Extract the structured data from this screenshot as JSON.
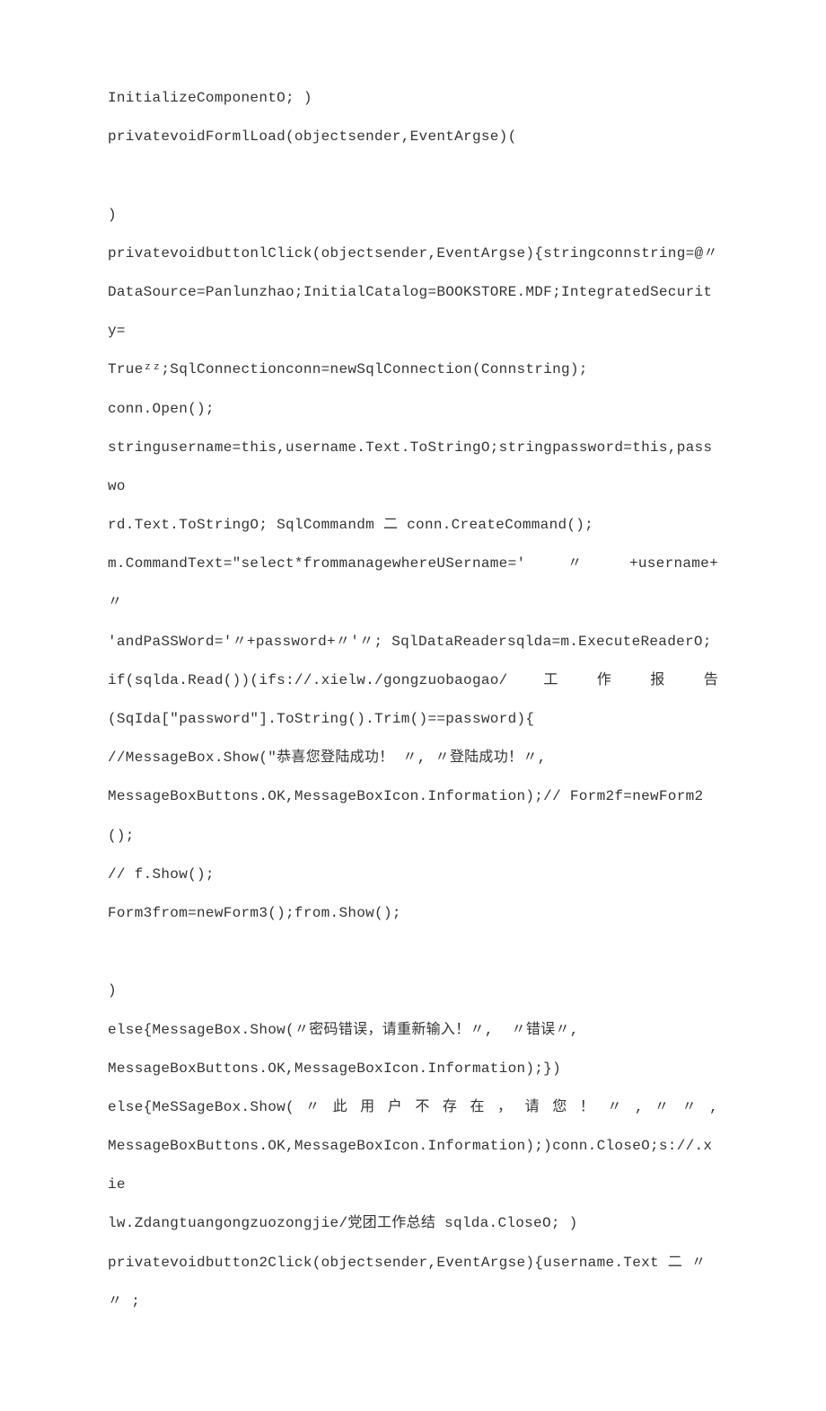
{
  "lines": [
    {
      "text": "InitializeComponentO; )",
      "cls": "line mono"
    },
    {
      "text": "privatevoidFormlLoad(objectsender,EventArgse)(",
      "cls": "line mono"
    },
    {
      "text": " ",
      "cls": "line"
    },
    {
      "text": ")",
      "cls": "line mono"
    },
    {
      "text": "privatevoidbuttonlClick(objectsender,EventArgse){stringconnstring=@〃",
      "cls": "line mono"
    },
    {
      "text": "DataSource=Panlunzhao;InitialCatalog=BOOKSTORE.MDF;IntegratedSecurity=",
      "cls": "line mono"
    },
    {
      "text": "Trueᶻᶻ;SqlConnectionconn=newSqlConnection(Connstring);",
      "cls": "line mono"
    },
    {
      "text": "conn.Open();",
      "cls": "line mono"
    },
    {
      "text": "stringusername=this,username.Text.ToStringO;stringpassword=this,passwo",
      "cls": "line mono"
    },
    {
      "text": "rd.Text.ToStringO; SqlCommandm 二 conn.CreateCommand();",
      "cls": "line mono"
    },
    {
      "text": "m.CommandText=\"select*frommanagewhereUSername='   〃   +username+   〃",
      "cls": "line mono justify"
    },
    {
      "text": "'andPaSSWord='〃+password+〃'〃; SqlDataReadersqlda=m.ExecuteReaderO;",
      "cls": "line mono"
    },
    {
      "text": "if(sqlda.Read())(ifs://.xielw./gongzuobaogao/   工   作   报   告",
      "cls": "line mono justify"
    },
    {
      "text": "(SqIda[\"password\"].ToString().Trim()==password){",
      "cls": "line mono"
    },
    {
      "text": "//MessageBox.Show(\"恭喜您登陆成功！ 〃, 〃登陆成功！〃,",
      "cls": "line mono"
    },
    {
      "text": "MessageBoxButtons.OK,MessageBoxIcon.Information);// Form2f=newForm2();",
      "cls": "line mono"
    },
    {
      "text": "// f.Show();",
      "cls": "line mono"
    },
    {
      "text": "Form3from=newForm3();from.Show();",
      "cls": "line mono"
    },
    {
      "text": " ",
      "cls": "line"
    },
    {
      "text": ")",
      "cls": "line mono"
    },
    {
      "text": "else{MessageBox.Show(〃密码错误，请重新输入！〃,  〃错误〃,",
      "cls": "line mono"
    },
    {
      "text": "MessageBoxButtons.OK,MessageBoxIcon.Information);})",
      "cls": "line mono"
    },
    {
      "text": "else{MeSSageBox.Show( 〃 此 用 户 不 存 在 ， 请 您 ！ 〃 , 〃 〃 ,",
      "cls": "line mono justify"
    },
    {
      "text": "MessageBoxButtons.OK,MessageBoxIcon.Information);)conn.CloseO;s://.xie",
      "cls": "line mono"
    },
    {
      "text": "lw.Zdangtuangongzuozongjie/党团工作总结 sqlda.CloseO; )",
      "cls": "line mono"
    },
    {
      "text": "privatevoidbutton2Click(objectsender,EventArgse){username.Text 二 〃 〃 ;",
      "cls": "line mono"
    }
  ]
}
